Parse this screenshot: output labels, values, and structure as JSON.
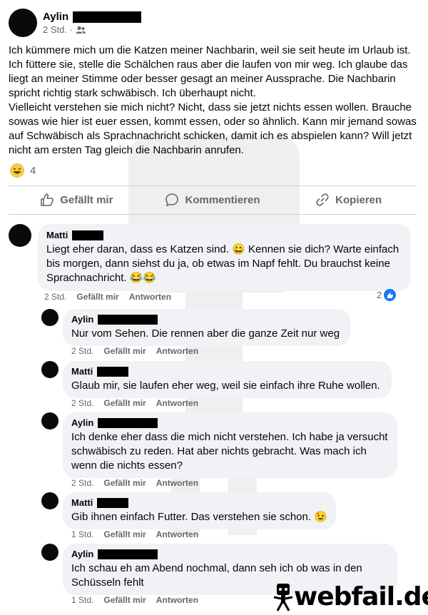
{
  "post": {
    "author": "Aylin",
    "time": "2 Std. ·",
    "audience_icon": "friends-icon",
    "text": "Ich kümmere mich um die Katzen meiner Nachbarin, weil sie seit heute im Urlaub ist. Ich füttere sie, stelle die Schälchen raus aber die laufen von mir weg. Ich glaube das liegt an meiner Stimme oder besser gesagt an meiner Aussprache. Die Nachbarin spricht richtig stark schwäbisch. Ich überhaupt nicht.\nVielleicht verstehen sie mich nicht? Nicht, dass sie jetzt nichts essen wollen. Brauche sowas wie hier ist euer essen, kommt essen, oder so ähnlich. Kann mir jemand sowas auf Schwäbisch als Sprachnachricht schicken, damit ich es abspielen kann? Will jetzt nicht am ersten Tag gleich die Nachbarin anrufen.",
    "reaction_icon": "laughing-emoji-icon",
    "reaction_count": "4"
  },
  "actions": {
    "like": "Gefällt mir",
    "comment": "Kommentieren",
    "copy": "Kopieren"
  },
  "comments": [
    {
      "author": "Matti",
      "text": "Liegt eher daran, dass es Katzen sind. 😀 Kennen sie dich? Warte einfach bis morgen, dann siehst du ja, ob etwas im Napf fehlt. Du brauchst keine Sprachnachricht. 😂😂",
      "time": "2 Std.",
      "like": "Gefällt mir",
      "reply": "Antworten",
      "likes": "2"
    },
    {
      "author": "Aylin",
      "text": "Nur vom Sehen. Die rennen aber die ganze Zeit nur weg",
      "time": "2 Std.",
      "like": "Gefällt mir",
      "reply": "Antworten"
    },
    {
      "author": "Matti",
      "text": "Glaub mir, sie laufen eher weg, weil sie einfach ihre Ruhe wollen.",
      "time": "2 Std.",
      "like": "Gefällt mir",
      "reply": "Antworten"
    },
    {
      "author": "Aylin",
      "text": "Ich denke eher dass die mich nicht verstehen. Ich habe ja versucht schwäbisch zu reden. Hat aber nichts gebracht. Was mach ich wenn die nichts essen?",
      "time": "2 Std.",
      "like": "Gefällt mir",
      "reply": "Antworten"
    },
    {
      "author": "Matti",
      "text": "Gib ihnen einfach Futter. Das verstehen sie schon. 😉",
      "time": "1 Std.",
      "like": "Gefällt mir",
      "reply": "Antworten"
    },
    {
      "author": "Aylin",
      "text": "Ich schau eh am Abend nochmal, dann seh ich ob was in den Schüsseln fehlt",
      "time": "1 Std.",
      "like": "Gefällt mir",
      "reply": "Antworten"
    }
  ],
  "watermark": {
    "logo_text": "webfail.de"
  },
  "colors": {
    "accent": "#1877f2",
    "muted": "#65676b",
    "bubble": "#f0f2f5"
  }
}
